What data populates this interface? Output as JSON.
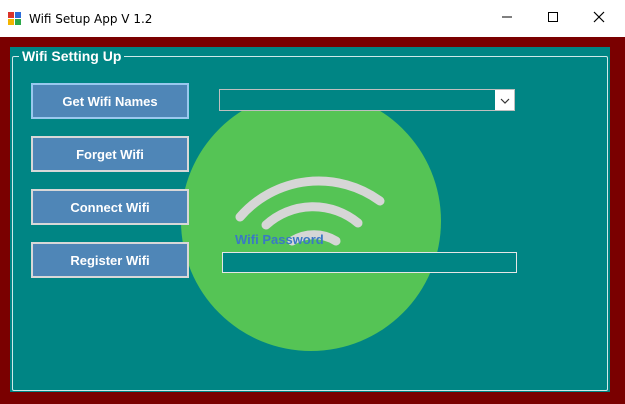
{
  "window": {
    "title": "Wifi Setup App V 1.2",
    "icon": "app-icon",
    "controls": [
      "minimize-icon",
      "maximize-icon",
      "close-icon"
    ]
  },
  "group": {
    "title": "Wifi Setting Up"
  },
  "buttons": {
    "get_wifi_names": "Get Wifi Names",
    "forget_wifi": "Forget Wifi",
    "connect_wifi": "Connect  Wifi",
    "register_wifi": "Register Wifi"
  },
  "wifi_dropdown": {
    "selected": ""
  },
  "password": {
    "label": "Wifi Password",
    "value": ""
  },
  "colors": {
    "frame": "#7a0000",
    "panel": "#008584",
    "button": "#4f86b7",
    "circle": "#55c455",
    "password_label": "#3a79c4"
  }
}
